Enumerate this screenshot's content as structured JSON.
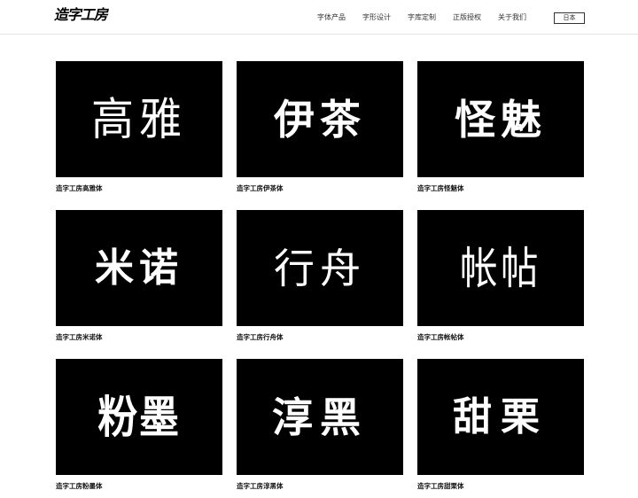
{
  "header": {
    "logo": "造字工房",
    "nav": [
      "字体产品",
      "字形设计",
      "字库定制",
      "正版授权",
      "关于我们"
    ],
    "lang_button": "日本"
  },
  "fonts": [
    {
      "sample": "高雅",
      "caption": "造字工房高雅体"
    },
    {
      "sample": "伊茶",
      "caption": "造字工房伊茶体"
    },
    {
      "sample": "怪魅",
      "caption": "造字工房怪魅体"
    },
    {
      "sample": "米诺",
      "caption": "造字工房米诺体"
    },
    {
      "sample": "行舟",
      "caption": "造字工房行舟体"
    },
    {
      "sample": "帐帖",
      "caption": "造字工房帐帖体"
    },
    {
      "sample": "粉墨",
      "caption": "造字工房粉墨体"
    },
    {
      "sample": "淳黑",
      "caption": "造字工房淳黑体"
    },
    {
      "sample": "甜栗",
      "caption": "造字工房甜栗体"
    }
  ]
}
